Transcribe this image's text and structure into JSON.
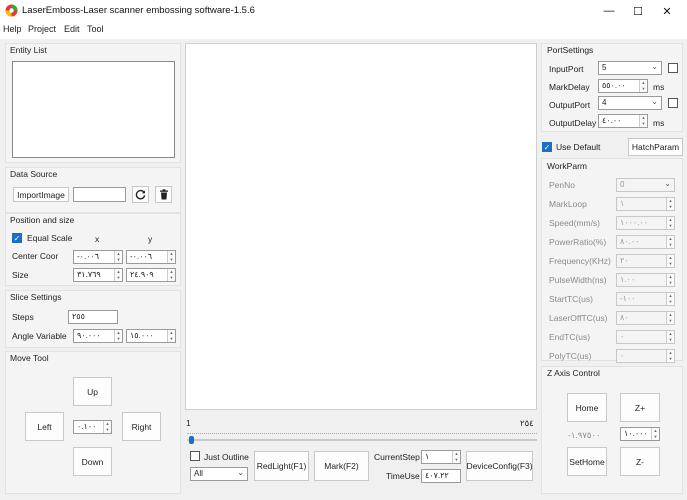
{
  "window": {
    "title": "LaserEmboss-Laser scanner embossing software-1.5.6",
    "minimize": "—",
    "maximize": "☐",
    "close": "✕"
  },
  "menu": [
    "Help",
    "Project",
    "Edit",
    "Tool"
  ],
  "entity_list": {
    "title": "Entity List"
  },
  "data_source": {
    "title": "Data Source",
    "import_label": "ImportImage",
    "path_value": ""
  },
  "position_size": {
    "title": "Position and size",
    "equal_scale_label": "Equal Scale",
    "col_x": "x",
    "col_y": "y",
    "center_label": "Center Coor",
    "center_x": "-٠.٠٠٦",
    "center_y": "-٠.٠٠٦",
    "size_label": "Size",
    "size_x": "٣١.٧٦٩",
    "size_y": "٢٤.٩٠٩"
  },
  "slice": {
    "title": "Slice Settings",
    "steps_label": "Steps",
    "steps_value": "٢٥٥",
    "angle_label": "Angle Variable",
    "angle_a": "٩٠.٠٠٠",
    "angle_b": "١٥.٠٠٠"
  },
  "move_tool": {
    "title": "Move Tool",
    "up": "Up",
    "down": "Down",
    "left": "Left",
    "right": "Right",
    "step_value": "٠.١٠٠"
  },
  "bottom": {
    "slider_min": "1",
    "slider_max": "٢٥٤",
    "slider_position": 0.005,
    "just_outline_label": "Just Outline",
    "scope_value": "All",
    "redlight_label": "RedLight(F1)",
    "mark_label": "Mark(F2)",
    "current_step_label": "CurrentStep",
    "current_step_value": "١",
    "time_use_label": "TimeUse",
    "time_use_value": "٤٠٧.٢٢",
    "device_config_label": "DeviceConfig(F3)"
  },
  "port_settings": {
    "title": "PortSettings",
    "input_port_label": "InputPort",
    "input_port_value": "5",
    "mark_delay_label": "MarkDelay",
    "mark_delay_value": "٥٥٠.٠٠",
    "mark_delay_unit": "ms",
    "output_port_label": "OutputPort",
    "output_port_value": "4",
    "output_delay_label": "OutputDelay",
    "output_delay_value": "٤٠.٠٠",
    "output_delay_unit": "ms"
  },
  "use_default_label": "Use Default",
  "hatch_param_label": "HatchParam",
  "work_param": {
    "title": "WorkParm",
    "rows": [
      {
        "label": "PenNo",
        "value": "0"
      },
      {
        "label": "MarkLoop",
        "value": "١"
      },
      {
        "label": "Speed(mm/s)",
        "value": "١٠٠٠.٠٠"
      },
      {
        "label": "PowerRatio(%)",
        "value": "٨٠.٠٠"
      },
      {
        "label": "Frequency(KHz)",
        "value": "٢٠"
      },
      {
        "label": "PulseWidth(ns)",
        "value": "١.٠٠"
      },
      {
        "label": "StartTC(us)",
        "value": "-١٠٠"
      },
      {
        "label": "LaserOffTC(us)",
        "value": "٨٠"
      },
      {
        "label": "EndTC(us)",
        "value": "٠"
      },
      {
        "label": "PolyTC(us)",
        "value": "٠"
      }
    ]
  },
  "z_axis": {
    "title": "Z Axis Control",
    "home": "Home",
    "z_plus": "Z+",
    "readout": "-١.٩٧٥٠٠",
    "step_value": "١٠.٠٠٠",
    "set_home": "SetHome",
    "z_minus": "Z-"
  },
  "colors": {
    "accent": "#1b6fc6",
    "slider_thumb": "#1b6fc6"
  }
}
